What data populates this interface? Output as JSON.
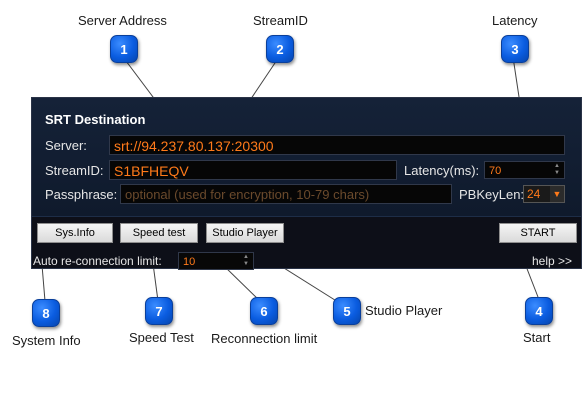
{
  "callouts": {
    "server_address": "Server Address",
    "streamid": "StreamID",
    "latency": "Latency",
    "start": "Start",
    "studio_player": "Studio Player",
    "reconnection_limit": "Reconnection limit",
    "speed_test": "Speed Test",
    "system_info": "System Info"
  },
  "badges": [
    "1",
    "2",
    "3",
    "4",
    "5",
    "6",
    "7",
    "8"
  ],
  "panel": {
    "title": "SRT Destination",
    "server_label": "Server:",
    "server_value": "srt://94.237.80.137:20300",
    "streamid_label": "StreamID:",
    "streamid_value": "S1BFHEQV",
    "latency_label": "Latency(ms):",
    "latency_value": "70",
    "passphrase_label": "Passphrase:",
    "passphrase_placeholder": "optional (used for encryption, 10-79 chars)",
    "pbkeylen_label": "PBKeyLen:",
    "pbkeylen_value": "24"
  },
  "buttons": {
    "sys_info": "Sys.Info",
    "speed_test": "Speed test",
    "studio_player": "Studio Player",
    "start": "START"
  },
  "footer": {
    "reconnect_label": "Auto re-connection limit:",
    "reconnect_value": "10",
    "help": "help >>"
  },
  "colors": {
    "accent_orange": "#ff7a1a",
    "badge_blue": "#0a5ce0",
    "panel_bg": "#0d0f18"
  }
}
